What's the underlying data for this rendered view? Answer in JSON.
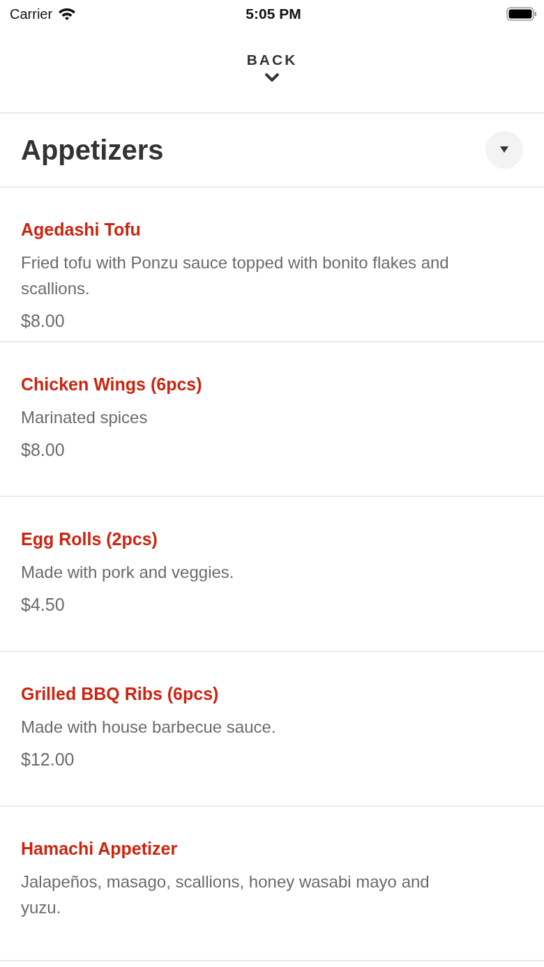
{
  "status_bar": {
    "carrier": "Carrier",
    "time": "5:05 PM"
  },
  "back": {
    "label": "BACK"
  },
  "category": {
    "title": "Appetizers"
  },
  "items": [
    {
      "name": "Agedashi Tofu",
      "description": "Fried tofu with Ponzu sauce topped with bonito flakes and scallions.",
      "price": "$8.00"
    },
    {
      "name": "Chicken Wings (6pcs)",
      "description": "Marinated spices",
      "price": "$8.00"
    },
    {
      "name": "Egg Rolls (2pcs)",
      "description": "Made with pork and veggies.",
      "price": "$4.50"
    },
    {
      "name": "Grilled BBQ Ribs (6pcs)",
      "description": "Made with house barbecue sauce.",
      "price": "$12.00"
    },
    {
      "name": "Hamachi Appetizer",
      "description": "Jalapeños, masago, scallions, honey wasabi mayo and yuzu."
    }
  ]
}
